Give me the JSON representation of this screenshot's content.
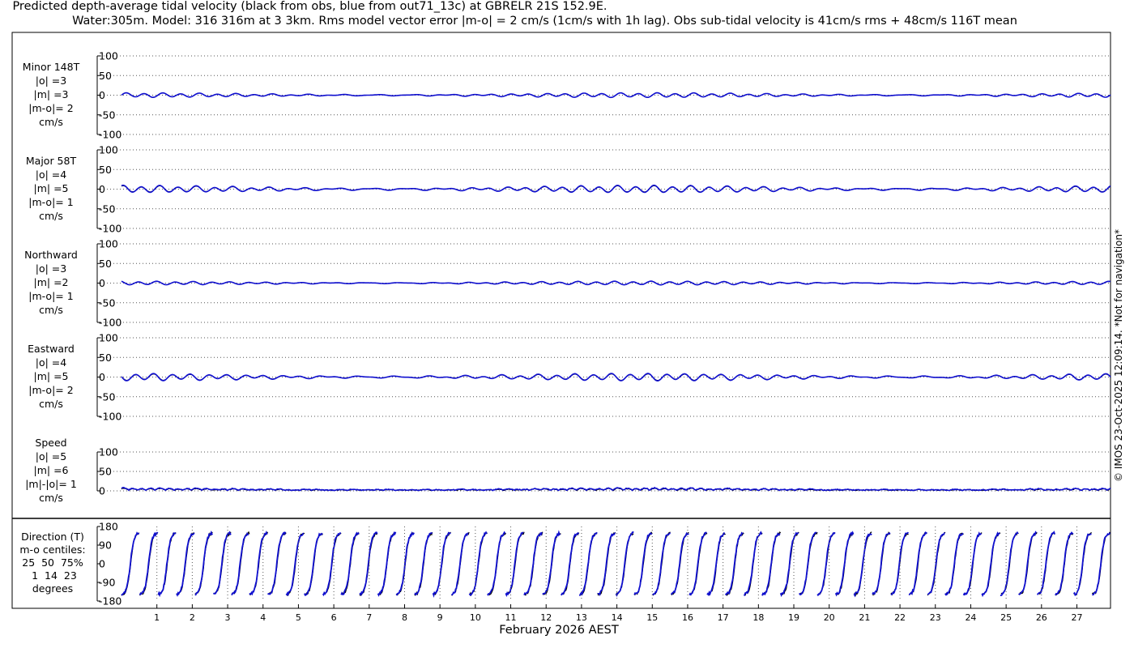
{
  "title": {
    "line1": "Predicted depth-average tidal velocity (black from obs, blue from out71_13c) at GBRELR 21S 152.9E.",
    "line2": "Water:305m. Model: 316 316m at 3 3km. Rms model vector error |m-o| = 2 cm/s (1cm/s with 1h lag). Obs sub-tidal velocity is 41cm/s rms + 48cm/s 116T mean"
  },
  "copyright": "© IMOS 23-Oct-2025 12:09:14. *Not for navigation*",
  "xlabel": "February 2026 AEST",
  "colors": {
    "obs": "#000000",
    "model": "#1010d0",
    "grid": "#555555"
  },
  "panel_labels": [
    {
      "lines": "Minor 148T\n|o| =3\n|m| =3\n|m-o|= 2\ncm/s"
    },
    {
      "lines": "Major 58T\n|o| =4\n|m| =5\n|m-o|= 1\ncm/s"
    },
    {
      "lines": "Northward\n|o| =3\n|m| =2\n|m-o|= 1\ncm/s"
    },
    {
      "lines": "Eastward\n|o| =4\n|m| =5\n|m-o|= 2\ncm/s"
    },
    {
      "lines": "Speed\n|o| =5\n|m| =6\n|m|-|o|= 1\ncm/s"
    }
  ],
  "direction_label": {
    "line1": "Direction (T)",
    "line2": "m-o centiles:",
    "line3": "25  50  75%",
    "line4": " 1  14  23",
    "line5": "degrees"
  },
  "chart_data": [
    {
      "type": "line",
      "name": "Minor 148T",
      "ylim": [
        -100,
        100
      ],
      "yticks": [
        100,
        50,
        0,
        -50,
        -100
      ],
      "amp_obs": 5,
      "amp_model": 5,
      "unit": "cm/s"
    },
    {
      "type": "line",
      "name": "Major 58T",
      "ylim": [
        -100,
        100
      ],
      "yticks": [
        100,
        50,
        0,
        -50,
        -100
      ],
      "amp_obs": 7,
      "amp_model": 8,
      "unit": "cm/s"
    },
    {
      "type": "line",
      "name": "Northward",
      "ylim": [
        -100,
        100
      ],
      "yticks": [
        100,
        50,
        0,
        -50,
        -100
      ],
      "amp_obs": 4,
      "amp_model": 4,
      "unit": "cm/s"
    },
    {
      "type": "line",
      "name": "Eastward",
      "ylim": [
        -100,
        100
      ],
      "yticks": [
        100,
        50,
        0,
        -50,
        -100
      ],
      "amp_obs": 7,
      "amp_model": 8,
      "unit": "cm/s"
    },
    {
      "type": "line",
      "name": "Speed",
      "ylim": [
        0,
        100
      ],
      "yticks": [
        100,
        50,
        0
      ],
      "amp_obs": 5,
      "amp_model": 6,
      "unit": "cm/s"
    },
    {
      "type": "line",
      "name": "Direction (T)",
      "ylim": [
        -180,
        180
      ],
      "yticks": [
        180,
        90,
        0,
        -90,
        -180
      ],
      "unit": "degrees T"
    }
  ],
  "x_axis": {
    "start_day": 0,
    "end_day": 27.95,
    "tick_labels": [
      "1",
      "2",
      "3",
      "4",
      "5",
      "6",
      "7",
      "8",
      "9",
      "10",
      "11",
      "12",
      "13",
      "14",
      "15",
      "16",
      "17",
      "18",
      "19",
      "20",
      "21",
      "22",
      "23",
      "24",
      "25",
      "26",
      "27"
    ]
  }
}
